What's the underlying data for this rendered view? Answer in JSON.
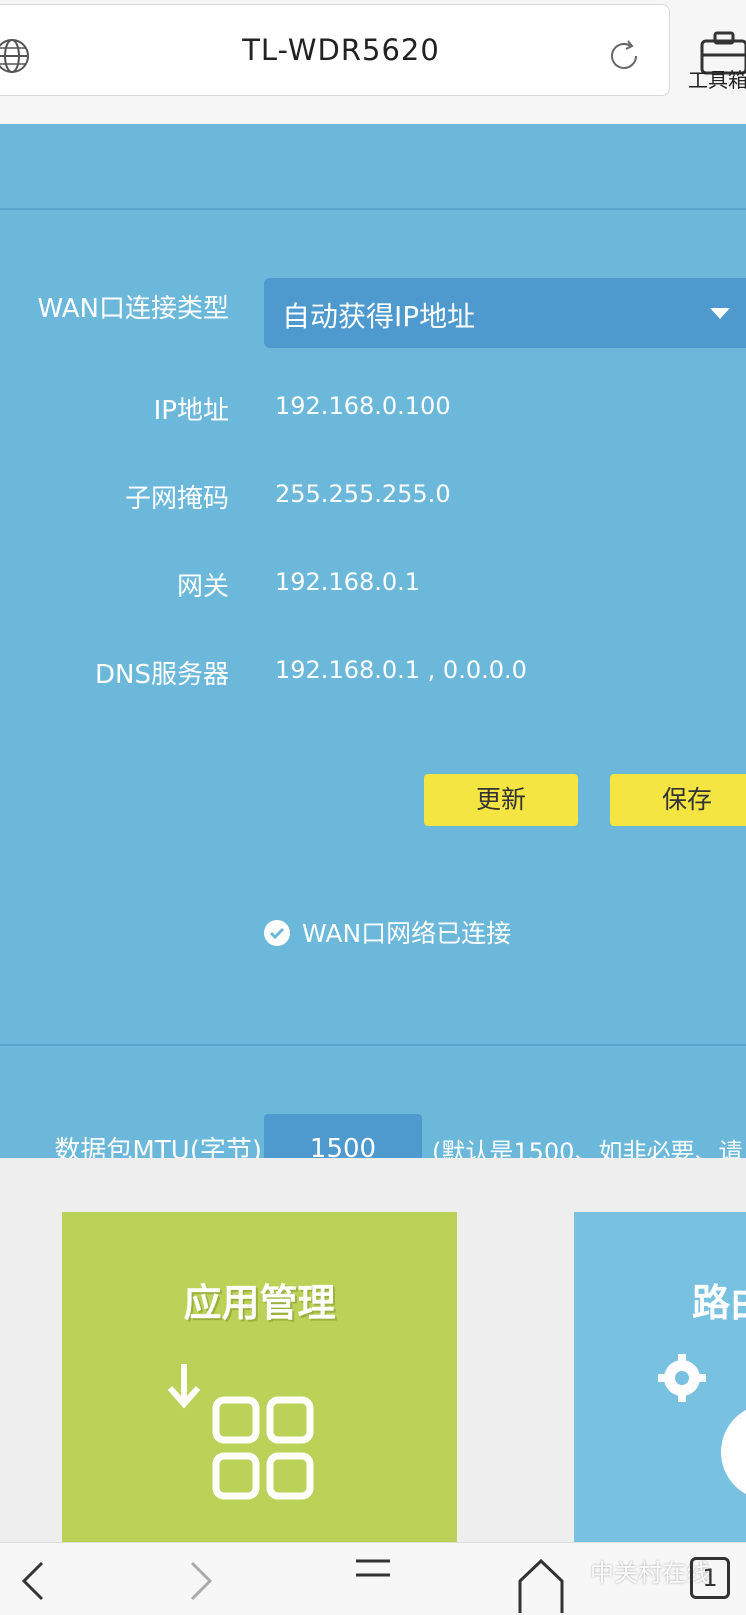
{
  "browser": {
    "title": "TL-WDR5620",
    "toolbox_label": "工具箱"
  },
  "wan": {
    "connection_type_label": "WAN口连接类型",
    "connection_type_value": "自动获得IP地址",
    "ip_label": "IP地址",
    "ip_value": "192.168.0.100",
    "mask_label": "子网掩码",
    "mask_value": "255.255.255.0",
    "gateway_label": "网关",
    "gateway_value": "192.168.0.1",
    "dns_label": "DNS服务器",
    "dns_value": "192.168.0.1 , 0.0.0.0",
    "refresh_label": "更新",
    "save_label": "保存",
    "status_text": "WAN口网络已连接",
    "mtu_label": "数据包MTU(字节)",
    "mtu_value": "1500",
    "mtu_hint": "(默认是1500、如非必要、请"
  },
  "tiles": {
    "app_title": "应用管理",
    "router_title": "路由"
  },
  "bottom_nav": {
    "tab_count": "1",
    "watermark": "中关村在线"
  },
  "colors": {
    "panel": "#6cb8db",
    "select": "#4e9acf",
    "button": "#f4e542",
    "app_tile": "#bcd158",
    "router_tile": "#79c1e1"
  }
}
